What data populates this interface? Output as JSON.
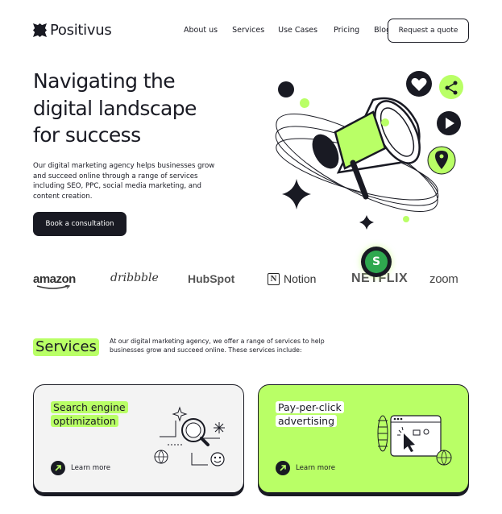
{
  "header": {
    "brand_name": "Positivus",
    "nav": [
      "About us",
      "Services",
      "Use Cases",
      "Pricing",
      "Blog"
    ],
    "quote_button": "Request a quote"
  },
  "hero": {
    "title_lines": [
      "Navigating the",
      "digital landscape",
      "for success"
    ],
    "description": "Our digital marketing agency helps businesses grow and succeed online through a range of services including SEO, PPC, social media marketing, and content creation.",
    "cta_label": "Book a consultation"
  },
  "logos": {
    "amazon": "amazon",
    "dribbble": "dribbble",
    "hubspot": "HubSpot",
    "notion": "Notion",
    "notion_mark": "N",
    "netflix": "NETFLIX",
    "zoom": "zoom",
    "floating_avatar_letter": "S"
  },
  "services": {
    "heading": "Services",
    "description": "At our digital marketing agency, we offer a range of services to help businesses grow and succeed online. These services include:",
    "cards": [
      {
        "title_lines": [
          "Search engine",
          "optimization"
        ],
        "link": "Learn more"
      },
      {
        "title_lines": [
          "Pay-per-click",
          "advertising"
        ],
        "link": "Learn more"
      }
    ]
  },
  "colors": {
    "accent": "#B9FF66",
    "dark": "#191A23",
    "light_gray": "#F3F3F3"
  },
  "icons": [
    "positivus-logo-icon",
    "megaphone-icon",
    "heart-icon",
    "share-icon",
    "play-icon",
    "location-pin-icon",
    "sparkle-star-icon",
    "arrow-up-right-icon",
    "magnifier-icon",
    "cursor-icon",
    "globe-icon",
    "smiley-icon"
  ]
}
